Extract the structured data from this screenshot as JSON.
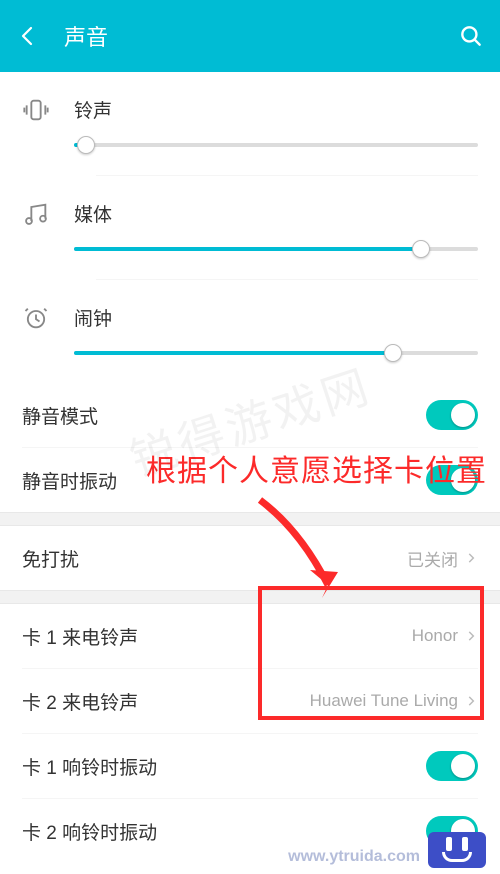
{
  "header": {
    "title": "声音"
  },
  "volumes": {
    "ringtone": {
      "label": "铃声",
      "percent": 3
    },
    "media": {
      "label": "媒体",
      "percent": 86
    },
    "alarm": {
      "label": "闹钟",
      "percent": 79
    }
  },
  "toggles": {
    "silent": {
      "label": "静音模式",
      "on": true
    },
    "vibrate_silent": {
      "label": "静音时振动",
      "on": true
    },
    "ring_vib1": {
      "label": "卡 1 响铃时振动",
      "on": true
    },
    "ring_vib2": {
      "label": "卡 2 响铃时振动",
      "on": true
    }
  },
  "nav": {
    "dnd": {
      "label": "免打扰",
      "value": "已关闭"
    },
    "sim1": {
      "label": "卡 1 来电铃声",
      "value": "Honor"
    },
    "sim2": {
      "label": "卡 2 来电铃声",
      "value": "Huawei Tune Living"
    }
  },
  "annotation": {
    "text": "根据个人意愿选择卡位置"
  },
  "watermark": {
    "diag": "锐得游戏网",
    "url": "www.ytruida.com"
  }
}
